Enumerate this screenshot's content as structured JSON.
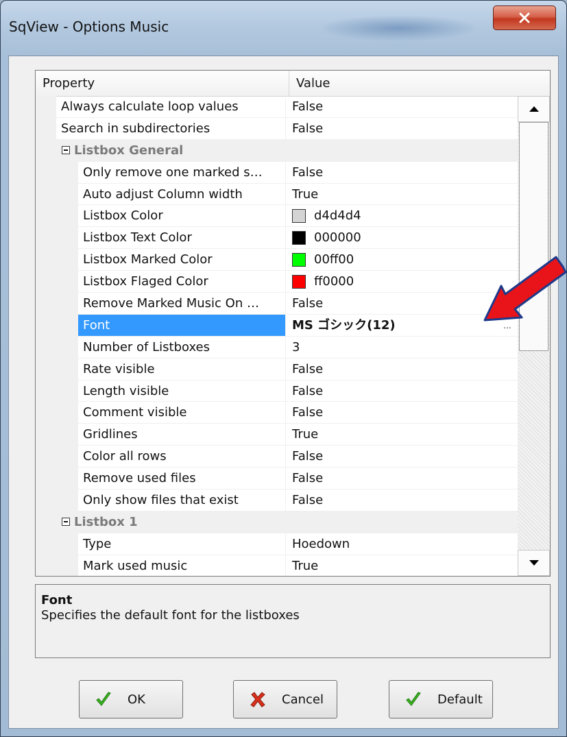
{
  "window": {
    "title": "SqView - Options Music"
  },
  "grid": {
    "header": {
      "property": "Property",
      "value": "Value"
    },
    "rows": [
      {
        "type": "prop",
        "level": 1,
        "name": "Always calculate loop values",
        "value": "False"
      },
      {
        "type": "prop",
        "level": 1,
        "name": "Search in subdirectories",
        "value": "False"
      },
      {
        "type": "cat",
        "name": "Listbox General"
      },
      {
        "type": "prop",
        "level": 2,
        "name": "Only remove one marked s…",
        "value": "False"
      },
      {
        "type": "prop",
        "level": 2,
        "name": "Auto adjust Column width",
        "value": "True"
      },
      {
        "type": "prop",
        "level": 2,
        "name": "Listbox Color",
        "value": "d4d4d4",
        "swatch": "#d4d4d4"
      },
      {
        "type": "prop",
        "level": 2,
        "name": "Listbox Text Color",
        "value": "000000",
        "swatch": "#000000"
      },
      {
        "type": "prop",
        "level": 2,
        "name": "Listbox Marked Color",
        "value": "00ff00",
        "swatch": "#00ff00"
      },
      {
        "type": "prop",
        "level": 2,
        "name": "Listbox Flaged Color",
        "value": "ff0000",
        "swatch": "#ff0000"
      },
      {
        "type": "prop",
        "level": 2,
        "name": "Remove Marked Music On …",
        "value": "False"
      },
      {
        "type": "prop",
        "level": 2,
        "name": "Font",
        "value": "MS ゴシック(12)",
        "selected": true,
        "bold": true,
        "button": "..."
      },
      {
        "type": "prop",
        "level": 2,
        "name": "Number of Listboxes",
        "value": "3"
      },
      {
        "type": "prop",
        "level": 2,
        "name": "Rate visible",
        "value": "False"
      },
      {
        "type": "prop",
        "level": 2,
        "name": "Length visible",
        "value": "False"
      },
      {
        "type": "prop",
        "level": 2,
        "name": "Comment visible",
        "value": "False"
      },
      {
        "type": "prop",
        "level": 2,
        "name": "Gridlines",
        "value": "True"
      },
      {
        "type": "prop",
        "level": 2,
        "name": "Color all rows",
        "value": "False"
      },
      {
        "type": "prop",
        "level": 2,
        "name": "Remove used files",
        "value": "False"
      },
      {
        "type": "prop",
        "level": 2,
        "name": "Only show files that exist",
        "value": "False"
      },
      {
        "type": "cat",
        "name": "Listbox 1"
      },
      {
        "type": "prop",
        "level": 2,
        "name": "Type",
        "value": "Hoedown"
      },
      {
        "type": "prop",
        "level": 2,
        "name": "Mark used music",
        "value": "True"
      }
    ]
  },
  "description": {
    "title": "Font",
    "text": "Specifies the default font for the listboxes"
  },
  "buttons": {
    "ok": "OK",
    "cancel": "Cancel",
    "default": "Default"
  },
  "colors": {
    "selection": "#3399ff",
    "annotation_arrow": "#e8141a",
    "ok_check": "#3cb521",
    "cancel_x": "#d9301c"
  }
}
